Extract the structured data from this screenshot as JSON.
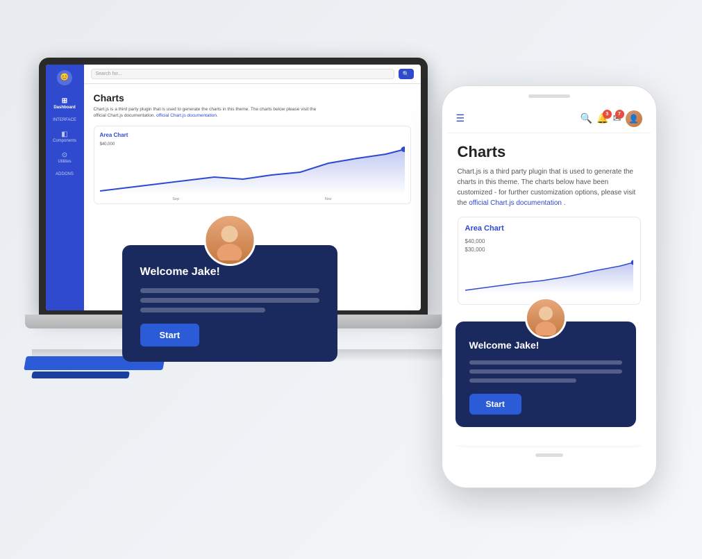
{
  "laptop": {
    "sidebar": {
      "logo": "😊",
      "items": [
        {
          "label": "Dashboard",
          "icon": "⊞",
          "active": true
        },
        {
          "label": "INTERFACE",
          "icon": "",
          "active": false
        },
        {
          "label": "Components",
          "icon": "◧",
          "active": false
        },
        {
          "label": "Utilities",
          "icon": "⊙",
          "active": false
        },
        {
          "label": "ADDONS",
          "icon": "",
          "active": false
        }
      ]
    },
    "topbar": {
      "search_placeholder": "Search for...",
      "search_btn": "🔍"
    },
    "page": {
      "title": "Charts",
      "description": "Chart.js is a third party plugin that is used to generate the charts in this theme. The charts below please visit the official Chart.js documentation.",
      "link_text": "official Chart.js documentation"
    },
    "chart": {
      "title": "Area Chart",
      "y_labels": [
        "$40,000"
      ],
      "x_labels": [
        "Sep",
        "Nov"
      ],
      "code_ref": "chart-area-demo.js"
    }
  },
  "phone": {
    "topbar": {
      "menu_icon": "☰",
      "search_icon": "🔍",
      "notification_icon": "🔔",
      "notification_badge": "3",
      "message_icon": "✉",
      "message_badge": "7"
    },
    "page": {
      "title": "Charts",
      "description": "Chart.js is a third party plugin that is used to generate the charts in this theme. The charts below have been customized - for further customization options, please visit the ",
      "link_text": "official Chart.js documentation",
      "link_suffix": "."
    },
    "chart": {
      "title": "Area Chart",
      "y_labels": [
        "$40,000",
        "$30,000"
      ]
    }
  },
  "welcome_card": {
    "laptop": {
      "title": "Welcome Jake!",
      "lines": [
        1,
        2,
        3
      ],
      "start_label": "Start"
    },
    "mobile": {
      "title": "Welcome Jake!",
      "lines": [
        1,
        2,
        3
      ],
      "start_label": "Start"
    }
  },
  "colors": {
    "primary": "#2f4acf",
    "dark_card": "#1a2a5e",
    "start_btn": "#2b5bd7",
    "danger": "#e74c3c"
  }
}
